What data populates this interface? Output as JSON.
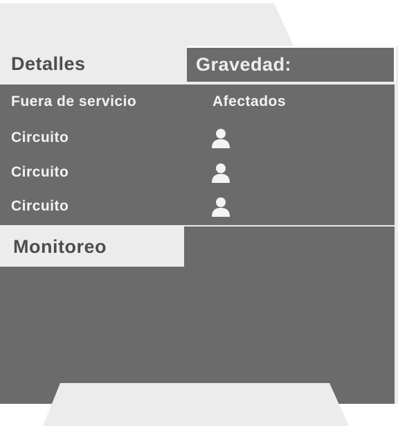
{
  "tabs": {
    "details_label": "Detalles",
    "gravity_label": "Gravedad:"
  },
  "table": {
    "col_out_of_service": "Fuera de servicio",
    "col_affected": "Afectados",
    "rows": [
      {
        "label": "Circuito",
        "icon": "user-icon"
      },
      {
        "label": "Circuito",
        "icon": "user-icon"
      },
      {
        "label": "Circuito",
        "icon": "user-icon"
      }
    ]
  },
  "monitoring": {
    "label": "Monitoreo"
  },
  "colors": {
    "panel_dark": "#6b6b6b",
    "panel_light": "#ececec",
    "text_dark": "#4d4d4d",
    "text_light": "#f3f3f3"
  }
}
